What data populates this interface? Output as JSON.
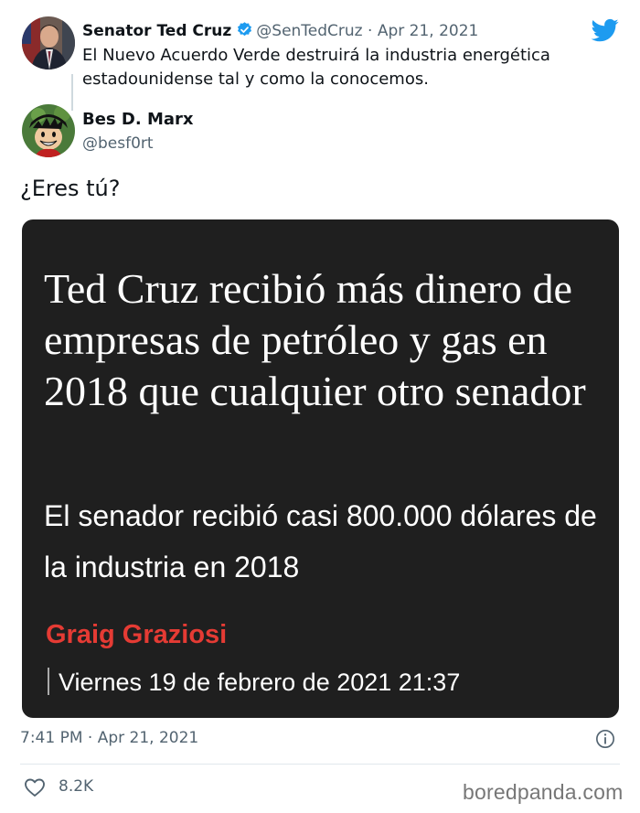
{
  "colors": {
    "twitter_blue": "#1d9bf0",
    "card_background": "#1f1f1f",
    "author_red": "#e53b34",
    "muted_text": "#536471"
  },
  "icons": {
    "brand": "twitter-bird-icon",
    "verified": "verified-badge-icon",
    "info": "info-icon",
    "like": "heart-icon"
  },
  "quoted_tweet": {
    "name": "Senator Ted Cruz",
    "handle": "@SenTedCruz",
    "separator": "·",
    "date": "Apr 21, 2021",
    "text": "El Nuevo Acuerdo Verde destruirá la industria energética estadounidense tal y como la conocemos."
  },
  "reply": {
    "name": "Bes D. Marx",
    "handle": "@besf0rt",
    "text": "¿Eres tú?"
  },
  "article_card": {
    "headline": "Ted Cruz recibió más dinero de empresas de petróleo y gas en 2018 que cualquier otro senador",
    "subheadline": "El senador recibió casi 800.000 dólares de la industria en 2018",
    "author": "Graig Graziosi",
    "date": "Viernes 19 de febrero de 2021 21:37"
  },
  "footer": {
    "timestamp": "7:41 PM · Apr 21, 2021",
    "like_count": "8.2K",
    "watermark": "boredpanda.com"
  }
}
